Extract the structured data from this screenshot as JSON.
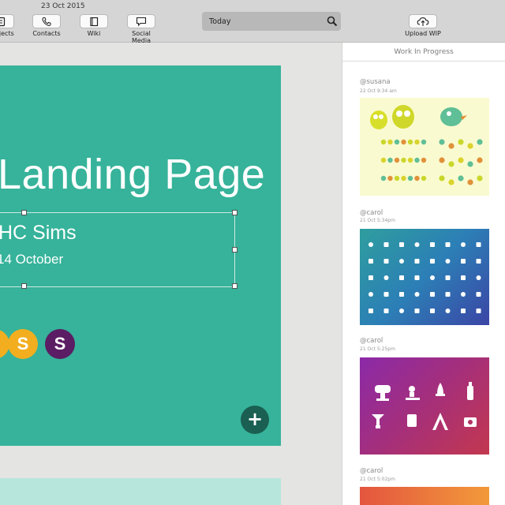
{
  "toolbar": {
    "date": "23 Oct 2015",
    "buttons": [
      {
        "label": "Projects",
        "icon": "projects-icon"
      },
      {
        "label": "Contacts",
        "icon": "phone-icon"
      },
      {
        "label": "Wiki",
        "icon": "book-icon"
      },
      {
        "label": "Social Media",
        "icon": "speech-bubble-icon"
      }
    ],
    "search": {
      "value": "Today",
      "icon": "search-icon"
    },
    "upload": {
      "label": "Upload WIP",
      "icon": "cloud-upload-icon"
    }
  },
  "slide": {
    "title": "Landing Page",
    "subtitle": "HC Sims",
    "date": "14 October",
    "avatars": [
      {
        "letter": "S",
        "color": "#f2ae1f"
      },
      {
        "letter": "S",
        "color": "#5b1d63"
      }
    ],
    "add_label": "+",
    "accent": "#36b39a"
  },
  "panel": {
    "title": "Work In Progress",
    "posts": [
      {
        "user": "@susana",
        "time": "22 Oct 9:34 am"
      },
      {
        "user": "@carol",
        "time": "21 Oct 5:34pm"
      },
      {
        "user": "@carol",
        "time": "21 Oct 5:25pm"
      },
      {
        "user": "@carol",
        "time": "21 Oct 5:02pm"
      }
    ]
  }
}
